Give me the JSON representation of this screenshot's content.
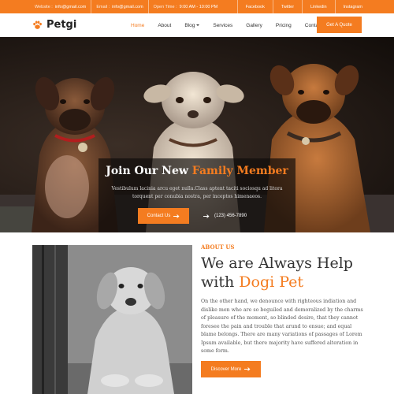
{
  "topbar": {
    "website_label": "Website :",
    "website_value": "info@gmail.com",
    "email_label": "Email :",
    "email_value": "info@gmail.com",
    "hours_label": "Open Time :",
    "hours_value": "9:00 AM - 10:00 PM",
    "social": [
      "Facebook",
      "Twitter",
      "Linkedin",
      "Instagram"
    ]
  },
  "nav": {
    "logo": "Petgi",
    "menu": [
      "Home",
      "About",
      "Blog",
      "Services",
      "Gallery",
      "Pricing",
      "Contact"
    ],
    "active": "Home",
    "quote_button": "Get A Quote"
  },
  "hero": {
    "title_plain": "Join Our New ",
    "title_accent": "Family Member",
    "text": "Vestibulum lacinia arcu eget nulla.Class aptent taciti sociosqu ad litora torquent per conubia nostra, per inceptos himenaeos.",
    "contact_button": "Contact Us",
    "phone": "(123) 456-7890"
  },
  "about": {
    "label": "ABOUT US",
    "title_line1": "We are Always Help",
    "title_plain": "with ",
    "title_accent": "Dogi Pet",
    "text": "On the other hand, we denounce with righteous indiation and dislike men who are so beguiled and demoralized by the charms of pleasure of the moment, so blinded desire, that they cannot foresee the pain and trouble that arund to ensue; and equal blame belongs. There are many variations of passages of Lorem Ipsum available, but there majority have suffered alteration in some form.",
    "discover_button": "Discover More"
  },
  "colors": {
    "accent": "#f47c20",
    "dark_overlay": "#0f0c0a"
  },
  "icons": [
    "paw-icon",
    "arrow-right-icon",
    "chevron-down-icon"
  ]
}
